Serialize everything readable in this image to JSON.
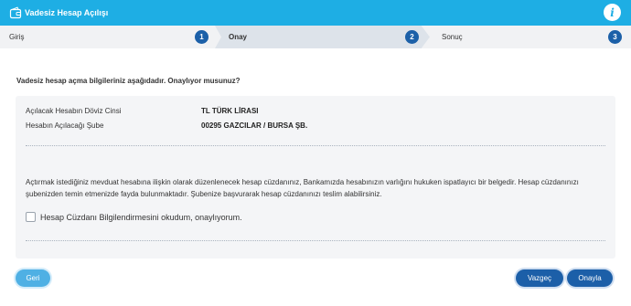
{
  "window": {
    "title": "Vadesiz Hesap Açılışı",
    "title_icon": "wallet-icon",
    "info_icon": "info-icon",
    "info_glyph": "i"
  },
  "steps": [
    {
      "label": "Giriş",
      "number": "1",
      "active": false
    },
    {
      "label": "Onay",
      "number": "2",
      "active": true
    },
    {
      "label": "Sonuç",
      "number": "3",
      "active": false
    }
  ],
  "question": "Vadesiz hesap açma bilgileriniz aşağıdadır. Onaylıyor musunuz?",
  "details": [
    {
      "label": "Açılacak Hesabın Döviz Cinsi",
      "value": "TL TÜRK LİRASI"
    },
    {
      "label": "Hesabın Açılacağı Şube",
      "value": "00295 GAZCILAR / BURSA ŞB."
    }
  ],
  "info_text": "Açtırmak istediğiniz mevduat hesabına ilişkin olarak düzenlenecek hesap cüzdanınız, Bankamızda hesabınızın varlığını hukuken ispatlayıcı bir belgedir. Hesap cüzdanınızı şubenizden temin etmenizde fayda bulunmaktadır. Şubenize başvurarak hesap cüzdanınızı teslim alabilirsiniz.",
  "checkbox": {
    "label": "Hesap Cüzdanı Bilgilendirmesini okudum, onaylıyorum.",
    "checked": false
  },
  "buttons": {
    "back": "Geri",
    "cancel": "Vazgeç",
    "confirm": "Onayla"
  },
  "colors": {
    "header": "#1eaee4",
    "step_number": "#1c60a8",
    "primary_button": "#1c5fa8",
    "back_button": "#4fb0e4"
  }
}
